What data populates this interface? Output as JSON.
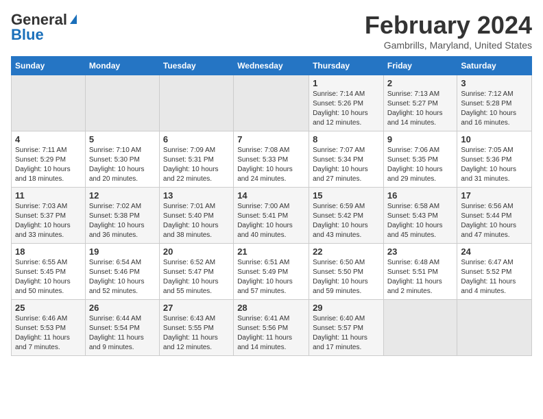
{
  "header": {
    "logo_general": "General",
    "logo_blue": "Blue",
    "month_year": "February 2024",
    "location": "Gambrills, Maryland, United States"
  },
  "weekdays": [
    "Sunday",
    "Monday",
    "Tuesday",
    "Wednesday",
    "Thursday",
    "Friday",
    "Saturday"
  ],
  "weeks": [
    [
      {
        "num": "",
        "sunrise": "",
        "sunset": "",
        "daylight": ""
      },
      {
        "num": "",
        "sunrise": "",
        "sunset": "",
        "daylight": ""
      },
      {
        "num": "",
        "sunrise": "",
        "sunset": "",
        "daylight": ""
      },
      {
        "num": "",
        "sunrise": "",
        "sunset": "",
        "daylight": ""
      },
      {
        "num": "1",
        "sunrise": "Sunrise: 7:14 AM",
        "sunset": "Sunset: 5:26 PM",
        "daylight": "Daylight: 10 hours and 12 minutes."
      },
      {
        "num": "2",
        "sunrise": "Sunrise: 7:13 AM",
        "sunset": "Sunset: 5:27 PM",
        "daylight": "Daylight: 10 hours and 14 minutes."
      },
      {
        "num": "3",
        "sunrise": "Sunrise: 7:12 AM",
        "sunset": "Sunset: 5:28 PM",
        "daylight": "Daylight: 10 hours and 16 minutes."
      }
    ],
    [
      {
        "num": "4",
        "sunrise": "Sunrise: 7:11 AM",
        "sunset": "Sunset: 5:29 PM",
        "daylight": "Daylight: 10 hours and 18 minutes."
      },
      {
        "num": "5",
        "sunrise": "Sunrise: 7:10 AM",
        "sunset": "Sunset: 5:30 PM",
        "daylight": "Daylight: 10 hours and 20 minutes."
      },
      {
        "num": "6",
        "sunrise": "Sunrise: 7:09 AM",
        "sunset": "Sunset: 5:31 PM",
        "daylight": "Daylight: 10 hours and 22 minutes."
      },
      {
        "num": "7",
        "sunrise": "Sunrise: 7:08 AM",
        "sunset": "Sunset: 5:33 PM",
        "daylight": "Daylight: 10 hours and 24 minutes."
      },
      {
        "num": "8",
        "sunrise": "Sunrise: 7:07 AM",
        "sunset": "Sunset: 5:34 PM",
        "daylight": "Daylight: 10 hours and 27 minutes."
      },
      {
        "num": "9",
        "sunrise": "Sunrise: 7:06 AM",
        "sunset": "Sunset: 5:35 PM",
        "daylight": "Daylight: 10 hours and 29 minutes."
      },
      {
        "num": "10",
        "sunrise": "Sunrise: 7:05 AM",
        "sunset": "Sunset: 5:36 PM",
        "daylight": "Daylight: 10 hours and 31 minutes."
      }
    ],
    [
      {
        "num": "11",
        "sunrise": "Sunrise: 7:03 AM",
        "sunset": "Sunset: 5:37 PM",
        "daylight": "Daylight: 10 hours and 33 minutes."
      },
      {
        "num": "12",
        "sunrise": "Sunrise: 7:02 AM",
        "sunset": "Sunset: 5:38 PM",
        "daylight": "Daylight: 10 hours and 36 minutes."
      },
      {
        "num": "13",
        "sunrise": "Sunrise: 7:01 AM",
        "sunset": "Sunset: 5:40 PM",
        "daylight": "Daylight: 10 hours and 38 minutes."
      },
      {
        "num": "14",
        "sunrise": "Sunrise: 7:00 AM",
        "sunset": "Sunset: 5:41 PM",
        "daylight": "Daylight: 10 hours and 40 minutes."
      },
      {
        "num": "15",
        "sunrise": "Sunrise: 6:59 AM",
        "sunset": "Sunset: 5:42 PM",
        "daylight": "Daylight: 10 hours and 43 minutes."
      },
      {
        "num": "16",
        "sunrise": "Sunrise: 6:58 AM",
        "sunset": "Sunset: 5:43 PM",
        "daylight": "Daylight: 10 hours and 45 minutes."
      },
      {
        "num": "17",
        "sunrise": "Sunrise: 6:56 AM",
        "sunset": "Sunset: 5:44 PM",
        "daylight": "Daylight: 10 hours and 47 minutes."
      }
    ],
    [
      {
        "num": "18",
        "sunrise": "Sunrise: 6:55 AM",
        "sunset": "Sunset: 5:45 PM",
        "daylight": "Daylight: 10 hours and 50 minutes."
      },
      {
        "num": "19",
        "sunrise": "Sunrise: 6:54 AM",
        "sunset": "Sunset: 5:46 PM",
        "daylight": "Daylight: 10 hours and 52 minutes."
      },
      {
        "num": "20",
        "sunrise": "Sunrise: 6:52 AM",
        "sunset": "Sunset: 5:47 PM",
        "daylight": "Daylight: 10 hours and 55 minutes."
      },
      {
        "num": "21",
        "sunrise": "Sunrise: 6:51 AM",
        "sunset": "Sunset: 5:49 PM",
        "daylight": "Daylight: 10 hours and 57 minutes."
      },
      {
        "num": "22",
        "sunrise": "Sunrise: 6:50 AM",
        "sunset": "Sunset: 5:50 PM",
        "daylight": "Daylight: 10 hours and 59 minutes."
      },
      {
        "num": "23",
        "sunrise": "Sunrise: 6:48 AM",
        "sunset": "Sunset: 5:51 PM",
        "daylight": "Daylight: 11 hours and 2 minutes."
      },
      {
        "num": "24",
        "sunrise": "Sunrise: 6:47 AM",
        "sunset": "Sunset: 5:52 PM",
        "daylight": "Daylight: 11 hours and 4 minutes."
      }
    ],
    [
      {
        "num": "25",
        "sunrise": "Sunrise: 6:46 AM",
        "sunset": "Sunset: 5:53 PM",
        "daylight": "Daylight: 11 hours and 7 minutes."
      },
      {
        "num": "26",
        "sunrise": "Sunrise: 6:44 AM",
        "sunset": "Sunset: 5:54 PM",
        "daylight": "Daylight: 11 hours and 9 minutes."
      },
      {
        "num": "27",
        "sunrise": "Sunrise: 6:43 AM",
        "sunset": "Sunset: 5:55 PM",
        "daylight": "Daylight: 11 hours and 12 minutes."
      },
      {
        "num": "28",
        "sunrise": "Sunrise: 6:41 AM",
        "sunset": "Sunset: 5:56 PM",
        "daylight": "Daylight: 11 hours and 14 minutes."
      },
      {
        "num": "29",
        "sunrise": "Sunrise: 6:40 AM",
        "sunset": "Sunset: 5:57 PM",
        "daylight": "Daylight: 11 hours and 17 minutes."
      },
      {
        "num": "",
        "sunrise": "",
        "sunset": "",
        "daylight": ""
      },
      {
        "num": "",
        "sunrise": "",
        "sunset": "",
        "daylight": ""
      }
    ]
  ]
}
